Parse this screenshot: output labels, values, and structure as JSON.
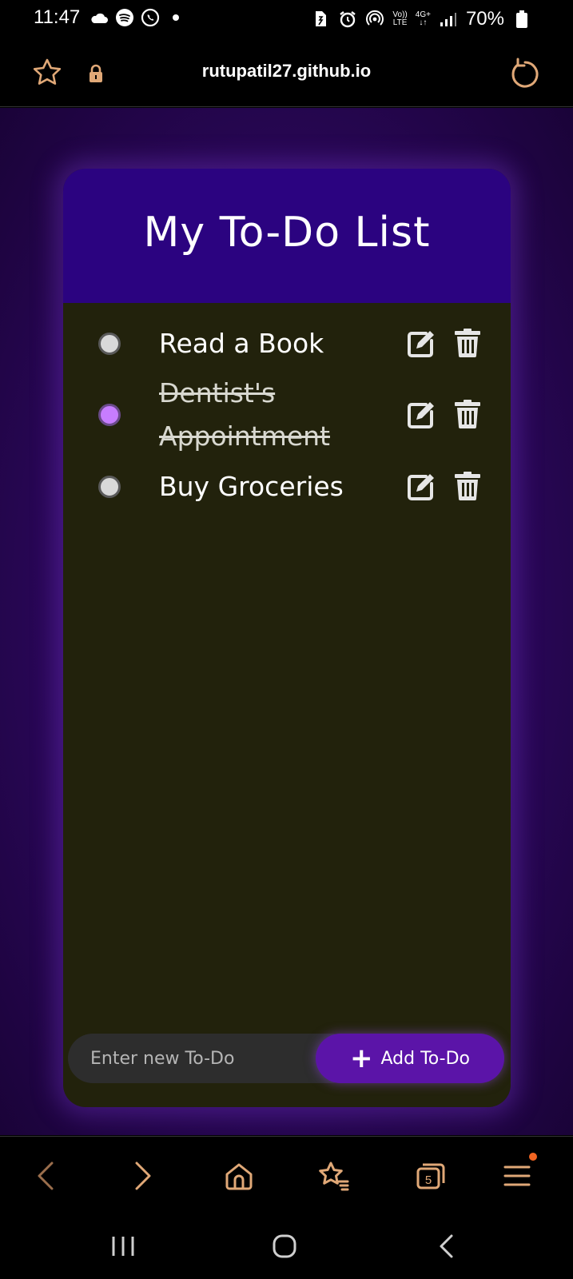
{
  "status_bar": {
    "time": "11:47",
    "battery": "70%",
    "network_top": "Vo))",
    "network_bottom": "LTE",
    "network_type": "4G+",
    "icons_left": [
      "cloud-icon",
      "spotify-icon",
      "whatsapp-icon",
      "dot-icon"
    ],
    "icons_right": [
      "sim-icon",
      "alarm-icon",
      "hotspot-icon",
      "signal-icon",
      "battery-icon"
    ]
  },
  "url_bar": {
    "url": "rutupatil27.github.io"
  },
  "app": {
    "title": "My To-Do List",
    "todos": [
      {
        "text": "Read a Book",
        "done": false
      },
      {
        "text": "Dentist's Appointment",
        "done": true
      },
      {
        "text": "Buy Groceries",
        "done": false
      }
    ],
    "input_placeholder": "Enter new To-Do",
    "add_label": "Add To-Do"
  },
  "toolbar": {
    "tab_count": "5"
  },
  "colors": {
    "accent": "#5b14a8",
    "header": "#2b0380",
    "card": "#22220c",
    "done_check": "#c77dff",
    "browser_icons": "#e0a877"
  }
}
